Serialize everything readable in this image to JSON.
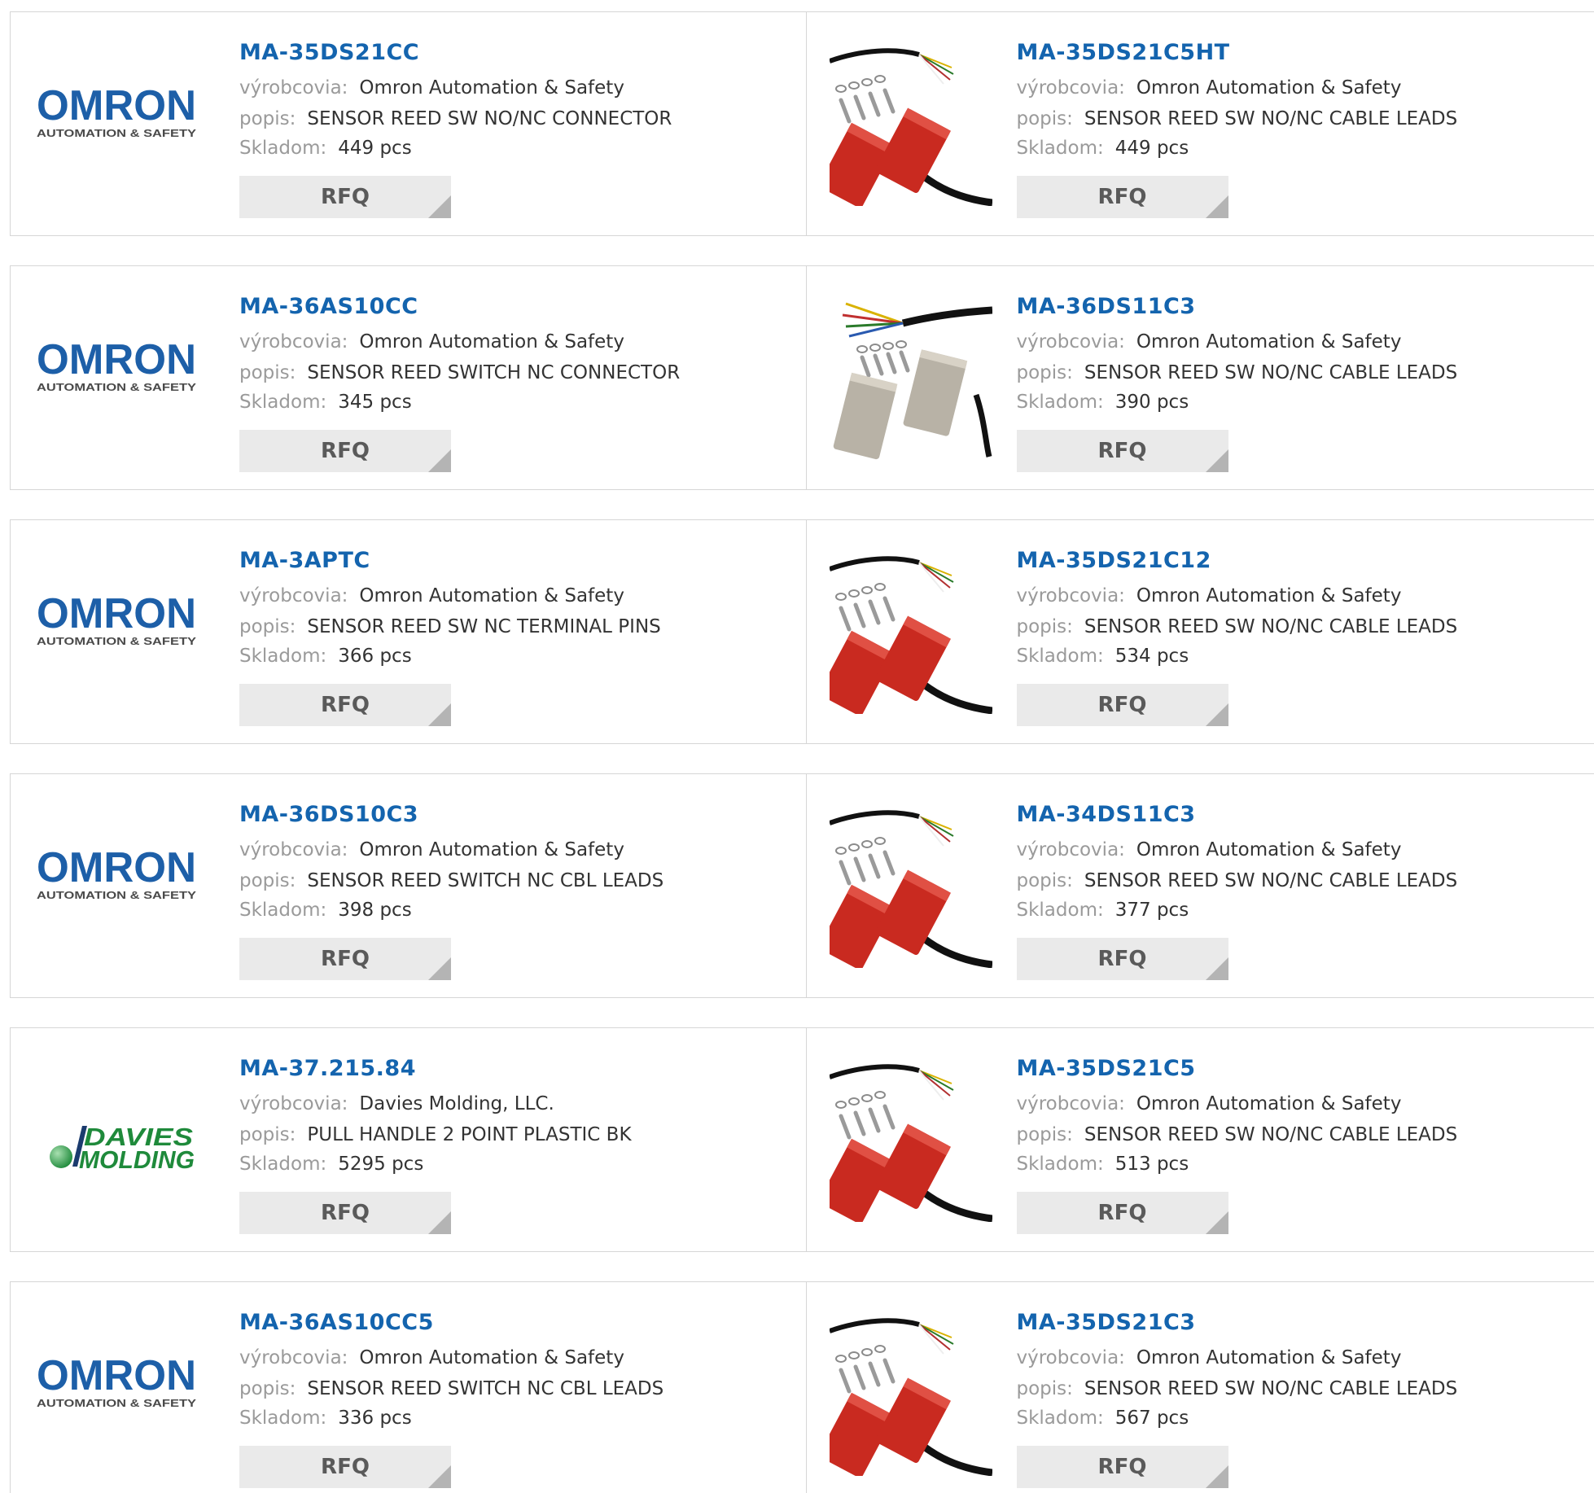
{
  "labels": {
    "manufacturer": "výrobcovia:",
    "description": "popis:",
    "stock": "Skladom:",
    "rfq": "RFQ"
  },
  "rows": [
    {
      "left": {
        "logo": "omron-logo",
        "part": "MA-35DS21CC",
        "manufacturer": "Omron Automation & Safety",
        "description": "SENSOR REED SW NO/NC CONNECTOR",
        "stock": "449 pcs"
      },
      "right": {
        "logo": "red-reed-sensor-photo",
        "part": "MA-35DS21C5HT",
        "manufacturer": "Omron Automation & Safety",
        "description": "SENSOR REED SW NO/NC CABLE LEADS",
        "stock": "449 pcs"
      }
    },
    {
      "left": {
        "logo": "omron-logo",
        "part": "MA-36AS10CC",
        "manufacturer": "Omron Automation & Safety",
        "description": "SENSOR REED SWITCH NC CONNECTOR",
        "stock": "345 pcs"
      },
      "right": {
        "logo": "steel-reed-sensor-photo",
        "part": "MA-36DS11C3",
        "manufacturer": "Omron Automation & Safety",
        "description": "SENSOR REED SW NO/NC CABLE LEADS",
        "stock": "390 pcs"
      }
    },
    {
      "left": {
        "logo": "omron-logo",
        "part": "MA-3APTC",
        "manufacturer": "Omron Automation & Safety",
        "description": "SENSOR REED SW NC TERMINAL PINS",
        "stock": "366 pcs"
      },
      "right": {
        "logo": "red-reed-sensor-photo",
        "part": "MA-35DS21C12",
        "manufacturer": "Omron Automation & Safety",
        "description": "SENSOR REED SW NO/NC CABLE LEADS",
        "stock": "534 pcs"
      }
    },
    {
      "left": {
        "logo": "omron-logo",
        "part": "MA-36DS10C3",
        "manufacturer": "Omron Automation & Safety",
        "description": "SENSOR REED SWITCH NC CBL LEADS",
        "stock": "398 pcs"
      },
      "right": {
        "logo": "red-reed-sensor-photo",
        "part": "MA-34DS11C3",
        "manufacturer": "Omron Automation & Safety",
        "description": "SENSOR REED SW NO/NC CABLE LEADS",
        "stock": "377 pcs"
      }
    },
    {
      "left": {
        "logo": "davies-molding-logo",
        "part": "MA-37.215.84",
        "manufacturer": "Davies Molding, LLC.",
        "description": "PULL HANDLE 2 POINT PLASTIC BK",
        "stock": "5295 pcs"
      },
      "right": {
        "logo": "red-reed-sensor-photo",
        "part": "MA-35DS21C5",
        "manufacturer": "Omron Automation & Safety",
        "description": "SENSOR REED SW NO/NC CABLE LEADS",
        "stock": "513 pcs"
      }
    },
    {
      "left": {
        "logo": "omron-logo",
        "part": "MA-36AS10CC5",
        "manufacturer": "Omron Automation & Safety",
        "description": "SENSOR REED SWITCH NC CBL LEADS",
        "stock": "336 pcs"
      },
      "right": {
        "logo": "red-reed-sensor-photo",
        "part": "MA-35DS21C3",
        "manufacturer": "Omron Automation & Safety",
        "description": "SENSOR REED SW NO/NC CABLE LEADS",
        "stock": "567 pcs"
      }
    }
  ],
  "colors": {
    "link": "#1464ae",
    "label": "#9a9a9a",
    "border": "#d6d6d6",
    "button_bg": "#eaeaea",
    "omron_blue": "#1d5fa8",
    "davies_green": "#1f8a3b",
    "sensor_red": "#c92a20"
  },
  "logo_text": {
    "omron_main": "OMRON",
    "omron_sub": "AUTOMATION & SAFETY",
    "davies_line1": "DAVIES",
    "davies_line2": "MOLDING"
  }
}
